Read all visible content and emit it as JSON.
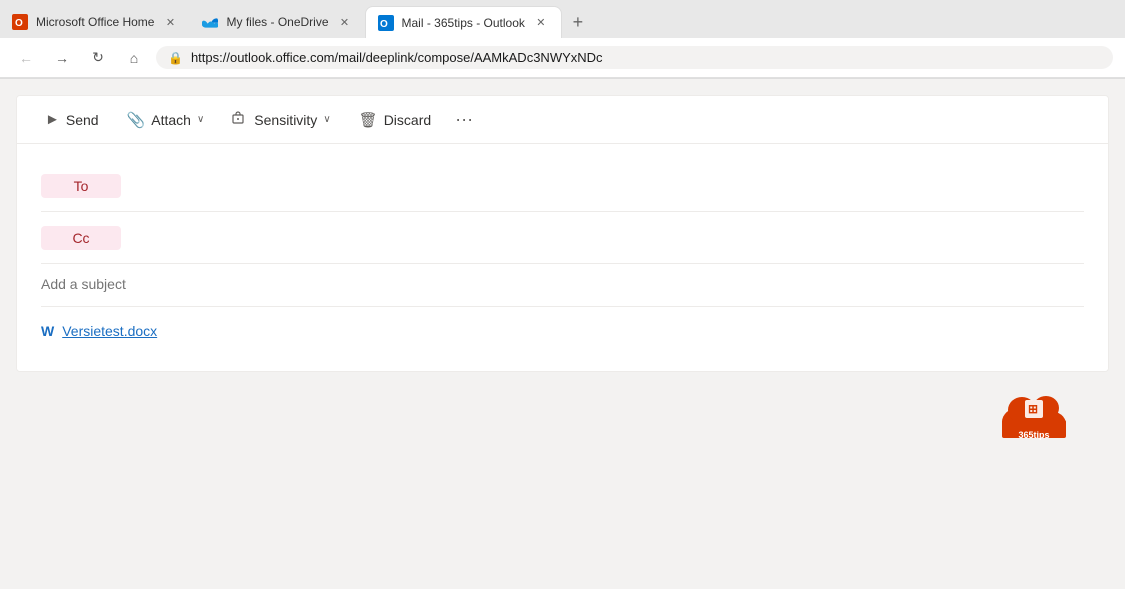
{
  "browser": {
    "tabs": [
      {
        "id": "tab-office",
        "label": "Microsoft Office Home",
        "icon": "office-icon",
        "active": false
      },
      {
        "id": "tab-onedrive",
        "label": "My files - OneDrive",
        "icon": "onedrive-icon",
        "active": false
      },
      {
        "id": "tab-outlook",
        "label": "Mail - 365tips - Outlook",
        "icon": "outlook-icon",
        "active": true
      }
    ],
    "new_tab_label": "+",
    "url": "https://outlook.office.com/mail/deeplink/compose/AAMkADc3NWYxNDc",
    "nav": {
      "back": "←",
      "forward": "→",
      "refresh": "↺",
      "home": "⌂"
    }
  },
  "toolbar": {
    "send_label": "Send",
    "attach_label": "Attach",
    "sensitivity_label": "Sensitivity",
    "discard_label": "Discard",
    "more_label": "···",
    "send_icon": "➤",
    "attach_icon": "📎",
    "sensitivity_icon": "🔖",
    "discard_icon": "🗑",
    "chevron_down": "∨"
  },
  "compose": {
    "to_label": "To",
    "cc_label": "Cc",
    "to_placeholder": "",
    "cc_placeholder": "",
    "subject_placeholder": "Add a subject",
    "attachment": {
      "filename": "Versietest.docx",
      "icon": "W"
    }
  },
  "badge": {
    "text": "365tips",
    "office_icon": "⊞"
  }
}
